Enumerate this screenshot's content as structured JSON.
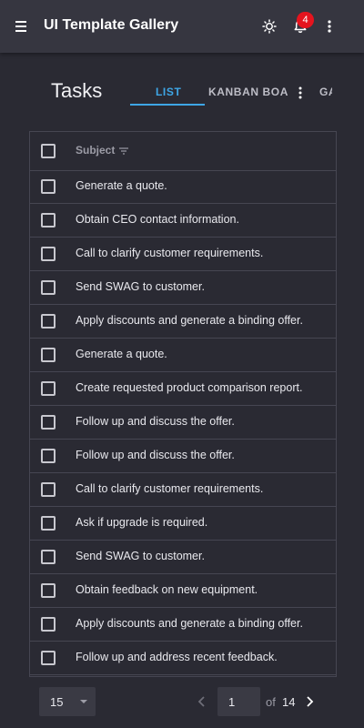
{
  "header": {
    "title": "UI Template Gallery",
    "notification_count": "4",
    "icons": [
      "menu-icon",
      "sun-icon",
      "bell-icon",
      "more-vert-icon"
    ]
  },
  "page": {
    "title": "Tasks",
    "tabs": [
      {
        "label": "LIST",
        "active": true
      },
      {
        "label": "KANBAN BOARD",
        "active": false
      },
      {
        "label": "GA",
        "active": false
      }
    ]
  },
  "grid": {
    "column_header": "Subject",
    "rows": [
      "Generate a quote.",
      "Obtain CEO contact information.",
      "Call to clarify customer requirements.",
      "Send SWAG to customer.",
      "Apply discounts and generate a binding offer.",
      "Generate a quote.",
      "Create requested product comparison report.",
      "Follow up and discuss the offer.",
      "Follow up and discuss the offer.",
      "Call to clarify customer requirements.",
      "Ask if upgrade is required.",
      "Send SWAG to customer.",
      "Obtain feedback on new equipment.",
      "Apply discounts and generate a binding offer.",
      "Follow up and address recent feedback."
    ]
  },
  "pager": {
    "page_size": "15",
    "current_page": "1",
    "of_label": "of",
    "total_pages": "14"
  },
  "colors": {
    "accent": "#3ea6e6",
    "badge": "#e5141e",
    "background": "#2a2a33",
    "toolbar": "#363640"
  }
}
